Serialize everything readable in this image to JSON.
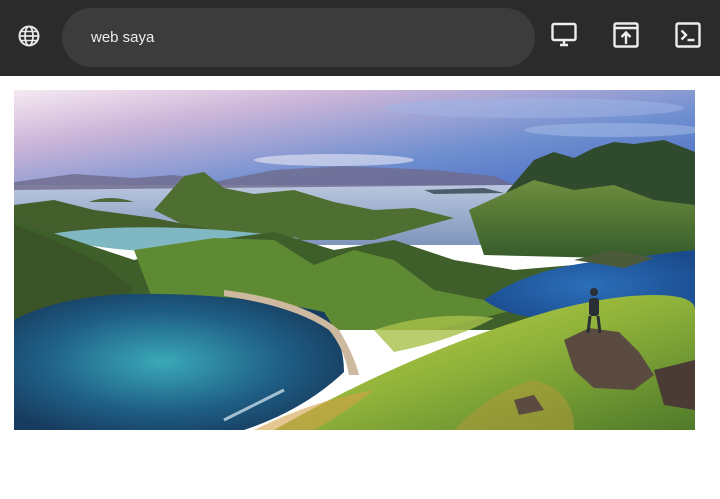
{
  "browser": {
    "address_value": "web saya",
    "icons": {
      "site": "globe-icon",
      "desktop": "monitor-icon",
      "open_window": "open-in-window-icon",
      "terminal": "terminal-icon"
    }
  },
  "main": {
    "hero_image": "landscape-photo"
  },
  "colors": {
    "topbar": "#2b2b2b",
    "urlbar": "#3c3c3c",
    "page": "#ffffff"
  }
}
